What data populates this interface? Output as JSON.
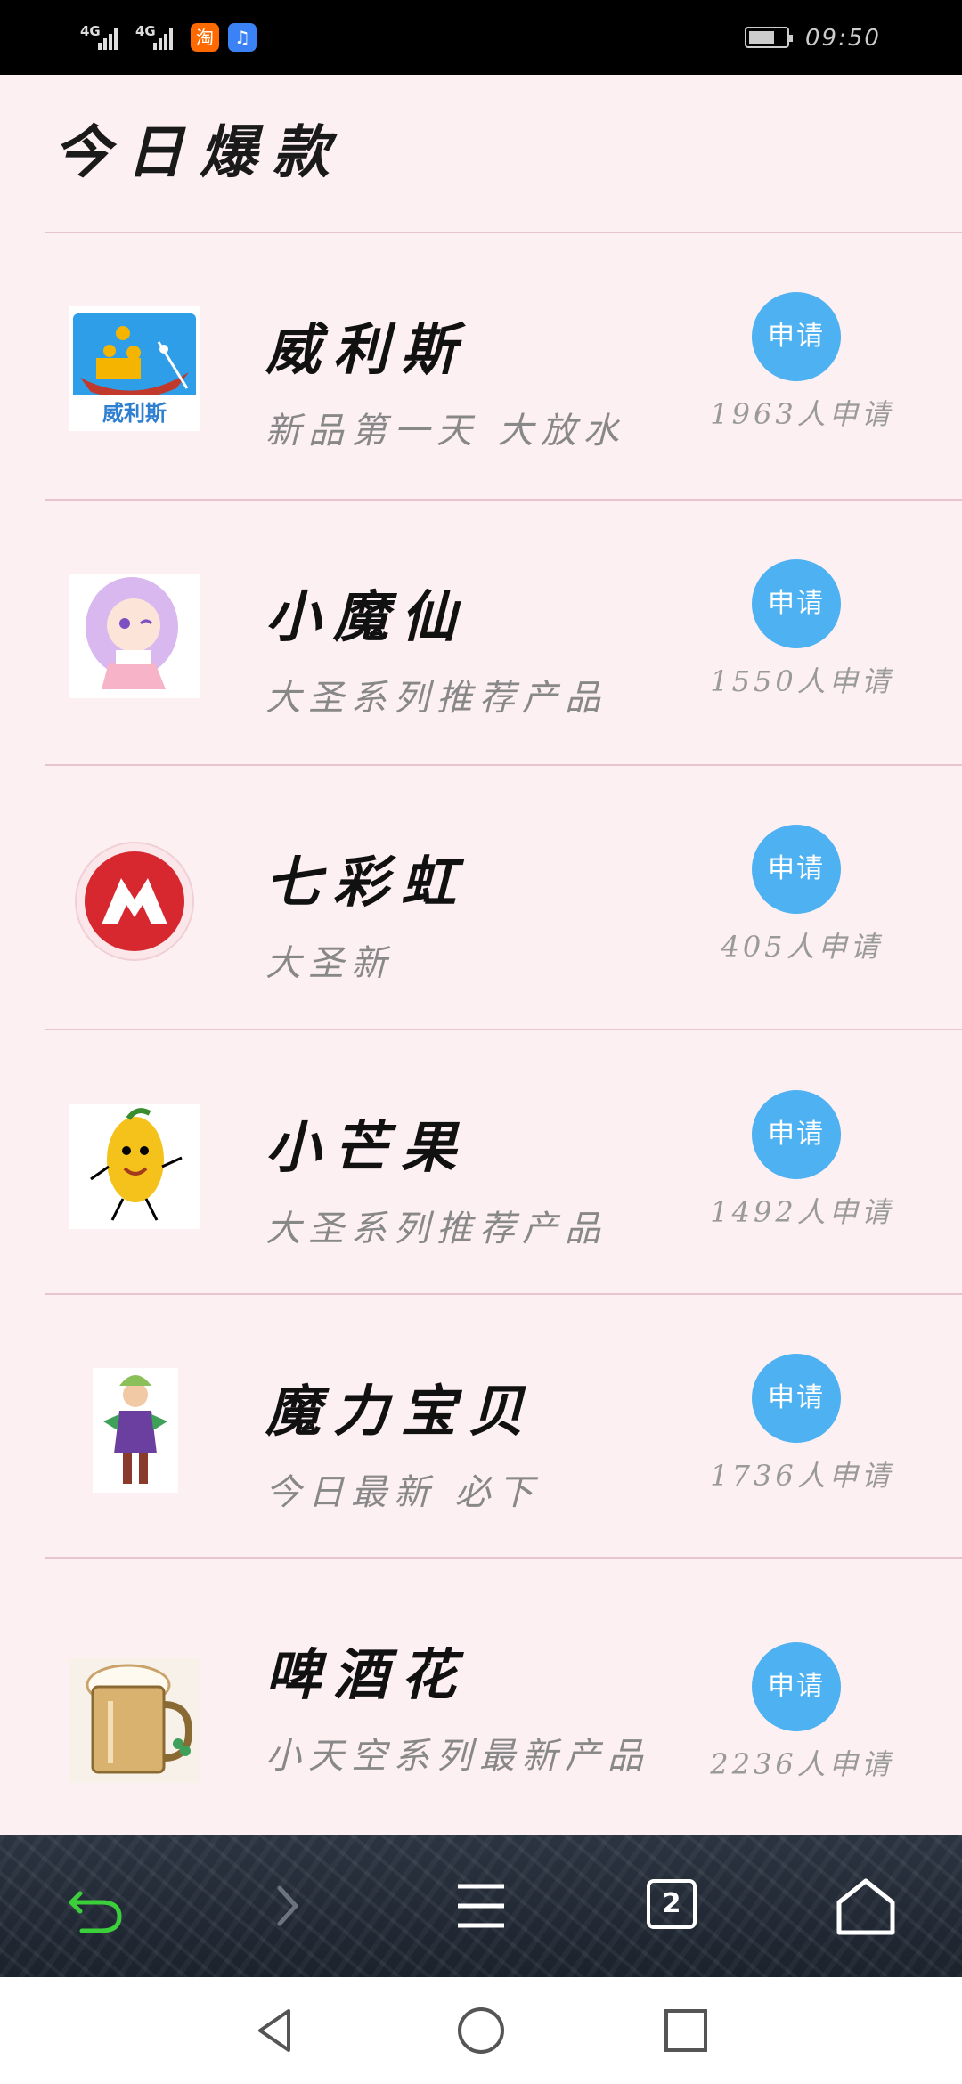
{
  "status_bar": {
    "network1": "4G",
    "network2": "4G",
    "apps": [
      {
        "name": "taobao-app-icon",
        "glyph": "淘",
        "color": "#ff6a00"
      },
      {
        "name": "music-app-icon",
        "glyph": "♫",
        "color": "#3b82f6"
      }
    ],
    "time": "09:50"
  },
  "header": {
    "title": "今日爆款"
  },
  "items": [
    {
      "name": "威利斯",
      "desc": "新品第一天 大放水",
      "count": "1963人申请",
      "button": "申请"
    },
    {
      "name": "小魔仙",
      "desc": "大圣系列推荐产品",
      "count": "1550人申请",
      "button": "申请"
    },
    {
      "name": "七彩虹",
      "desc": "大圣新",
      "count": "405人申请",
      "button": "申请"
    },
    {
      "name": "小芒果",
      "desc": "大圣系列推荐产品",
      "count": "1492人申请",
      "button": "申请"
    },
    {
      "name": "魔力宝贝",
      "desc": "今日最新 必下",
      "count": "1736人申请",
      "button": "申请"
    },
    {
      "name": "啤酒花",
      "desc": "小天空系列最新产品",
      "count": "2236人申请",
      "button": "申请"
    }
  ],
  "thumb_labels": {
    "weilisi": "威利斯"
  },
  "browser_bar": {
    "tab_count": "2"
  }
}
